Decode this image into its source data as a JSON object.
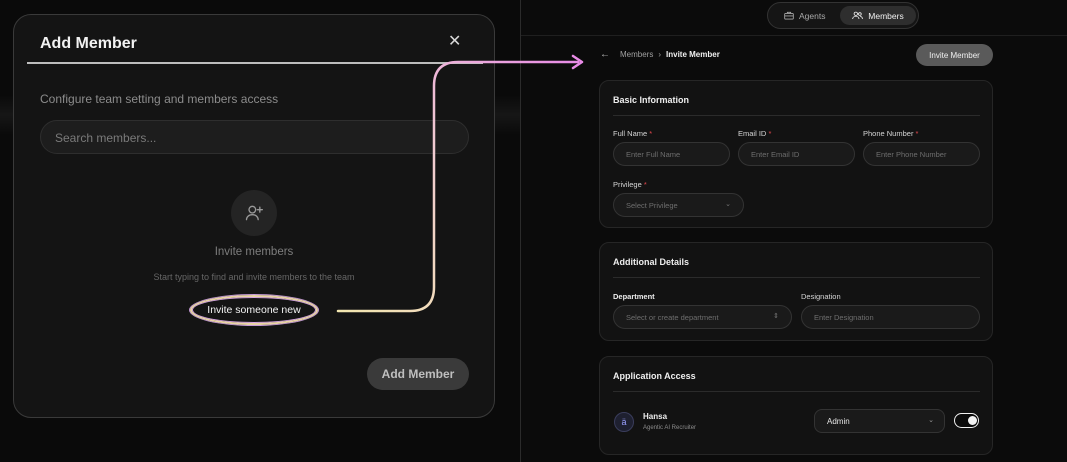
{
  "modal": {
    "title": "Add Member",
    "close_icon": "close-icon",
    "subtitle": "Configure team setting and members access",
    "search_placeholder": "Search members...",
    "invite_icon": "user-plus-icon",
    "invite_heading": "Invite members",
    "invite_description": "Start typing to find and invite members to the team",
    "invite_new_label": "Invite someone new",
    "add_member_label": "Add Member"
  },
  "topnav": {
    "agents_label": "Agents",
    "members_label": "Members",
    "active": "Members"
  },
  "breadcrumb": {
    "parent": "Members",
    "separator": "›",
    "current": "Invite Member"
  },
  "header_button": "Invite Member",
  "basic_info": {
    "title": "Basic Information",
    "full_name": {
      "label": "Full Name",
      "required": "*",
      "placeholder": "Enter Full Name"
    },
    "email": {
      "label": "Email ID",
      "required": "*",
      "placeholder": "Enter Email ID"
    },
    "phone": {
      "label": "Phone Number",
      "required": "*",
      "placeholder": "Enter Phone Number"
    },
    "privilege": {
      "label": "Privilege",
      "required": "*",
      "placeholder": "Select Privilege"
    }
  },
  "additional": {
    "title": "Additional Details",
    "department": {
      "label": "Department",
      "placeholder": "Select or create department"
    },
    "designation": {
      "label": "Designation",
      "placeholder": "Enter Designation"
    }
  },
  "app_access": {
    "title": "Application Access",
    "app_name": "Hansa",
    "app_subtitle": "Agentic AI Recruiter",
    "role": "Admin",
    "enabled": true
  },
  "colors": {
    "required": "#e5484d",
    "arrow_start": "#f3e7b0",
    "arrow_end": "#e88be6"
  }
}
